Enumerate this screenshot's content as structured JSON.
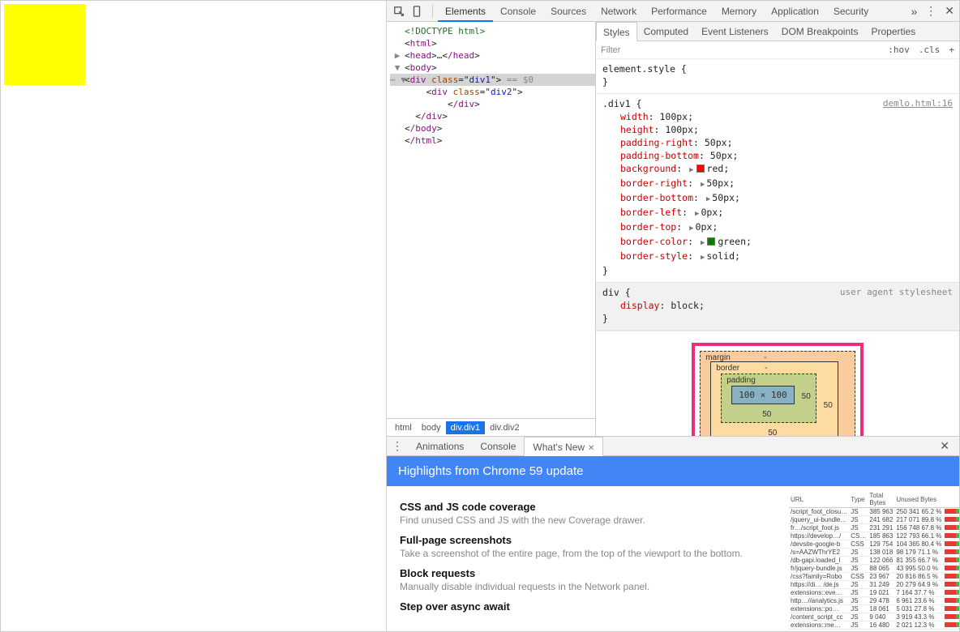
{
  "toolbar": {
    "tabs": [
      "Elements",
      "Console",
      "Sources",
      "Network",
      "Performance",
      "Memory",
      "Application",
      "Security"
    ],
    "active": "Elements"
  },
  "dom": {
    "doctype": "<!DOCTYPE html>",
    "html_open": "html",
    "head_open": "head",
    "head_ell": "…",
    "head_close": "/head",
    "body_open": "body",
    "div1_tag": "div",
    "div1_attr_name": "class",
    "div1_attr_val": "div1",
    "sel_suffix": "== $0",
    "div2_tag": "div",
    "div2_attr_name": "class",
    "div2_attr_val": "div2",
    "div_close": "/div",
    "body_close": "/body",
    "html_close": "/html"
  },
  "breadcrumb": [
    "html",
    "body",
    "div.div1",
    "div.div2"
  ],
  "breadcrumb_active": 2,
  "sub_tabs": [
    "Styles",
    "Computed",
    "Event Listeners",
    "DOM Breakpoints",
    "Properties"
  ],
  "filter": {
    "placeholder": "Filter",
    "hov": ":hov",
    "cls": ".cls",
    "plus": "+"
  },
  "rules": {
    "element_style": {
      "selector": "element.style {",
      "close": "}"
    },
    "div1": {
      "selector": ".div1 {",
      "source": "demlo.html:16",
      "decls": [
        {
          "p": "width",
          "v": "100px"
        },
        {
          "p": "height",
          "v": "100px"
        },
        {
          "p": "padding-right",
          "v": "50px"
        },
        {
          "p": "padding-bottom",
          "v": "50px"
        },
        {
          "p": "background",
          "v": "red",
          "sw": "#ff0000",
          "tri": true
        },
        {
          "p": "border-right",
          "v": "50px",
          "tri": true
        },
        {
          "p": "border-bottom",
          "v": "50px",
          "tri": true
        },
        {
          "p": "border-left",
          "v": "0px",
          "tri": true
        },
        {
          "p": "border-top",
          "v": "0px",
          "tri": true
        },
        {
          "p": "border-color",
          "v": "green",
          "sw": "#008000",
          "tri": true
        },
        {
          "p": "border-style",
          "v": "solid",
          "tri": true
        }
      ],
      "close": "}"
    },
    "div_ua": {
      "selector": "div {",
      "source": "user agent stylesheet",
      "decls": [
        {
          "p": "display",
          "v": "block"
        }
      ],
      "close": "}"
    }
  },
  "box_model": {
    "margin_label": "margin",
    "margin_val": "-",
    "border_label": "border",
    "border_val": "-",
    "padding_label": "padding",
    "padding_val": "-",
    "right": "50",
    "bottom": "50",
    "pad_right": "50",
    "pad_bottom": "50",
    "content": "100 × 100"
  },
  "drawer": {
    "tabs": [
      "Animations",
      "Console",
      "What's New"
    ],
    "active": 2,
    "headline": "Highlights from Chrome 59 update",
    "features": [
      {
        "t": "CSS and JS code coverage",
        "d": "Find unused CSS and JS with the new Coverage drawer."
      },
      {
        "t": "Full-page screenshots",
        "d": "Take a screenshot of the entire page, from the top of the viewport to the bottom."
      },
      {
        "t": "Block requests",
        "d": "Manually disable individual requests in the Network panel."
      },
      {
        "t": "Step over async await",
        "d": ""
      }
    ],
    "coverage": {
      "cols": [
        "URL",
        "Type",
        "Total Bytes",
        "Unused Bytes",
        ""
      ],
      "rows": [
        [
          "/script_foot_closu…",
          "JS",
          "385 963",
          "250 341 65.2 %"
        ],
        [
          "/jquery_ui-bundle…",
          "JS",
          "241 682",
          "217 071 89.8 %"
        ],
        [
          "fr…/script_foot.js",
          "JS",
          "231 291",
          "156 748 67.8 %"
        ],
        [
          "https://develop…/",
          "CS…",
          "185 863",
          "122 793 66.1 %"
        ],
        [
          "/devsite-google-b",
          "CSS",
          "129 754",
          "104 365 80.4 %"
        ],
        [
          "/s=AAZWThrYE2",
          "JS",
          "138 018",
          "98 179 71.1 %"
        ],
        [
          "/db-gapi.loaded_l",
          "JS",
          "122 066",
          "81 355 66.7 %"
        ],
        [
          "fr/jquery-bundle.js",
          "JS",
          "88 065",
          "43 995 50.0 %"
        ],
        [
          "/css?family=Robo",
          "CSS",
          "23 967",
          "20 816 86.5 %"
        ],
        [
          "https://di… /de.js",
          "JS",
          "31 249",
          "20 279 64.9 %"
        ],
        [
          "extensions::eve…",
          "JS",
          "19 021",
          "7 164 37.7 %"
        ],
        [
          "http…//analytics.js",
          "JS",
          "29 478",
          "6 961 23.6 %"
        ],
        [
          "extensions::po…",
          "JS",
          "18 061",
          "5 031 27.8 %"
        ],
        [
          "/content_script_cc",
          "JS",
          "9 040",
          "3 919 43.3 %"
        ],
        [
          "extensions::me…",
          "JS",
          "16 480",
          "2 021 12.3 %"
        ]
      ]
    }
  }
}
